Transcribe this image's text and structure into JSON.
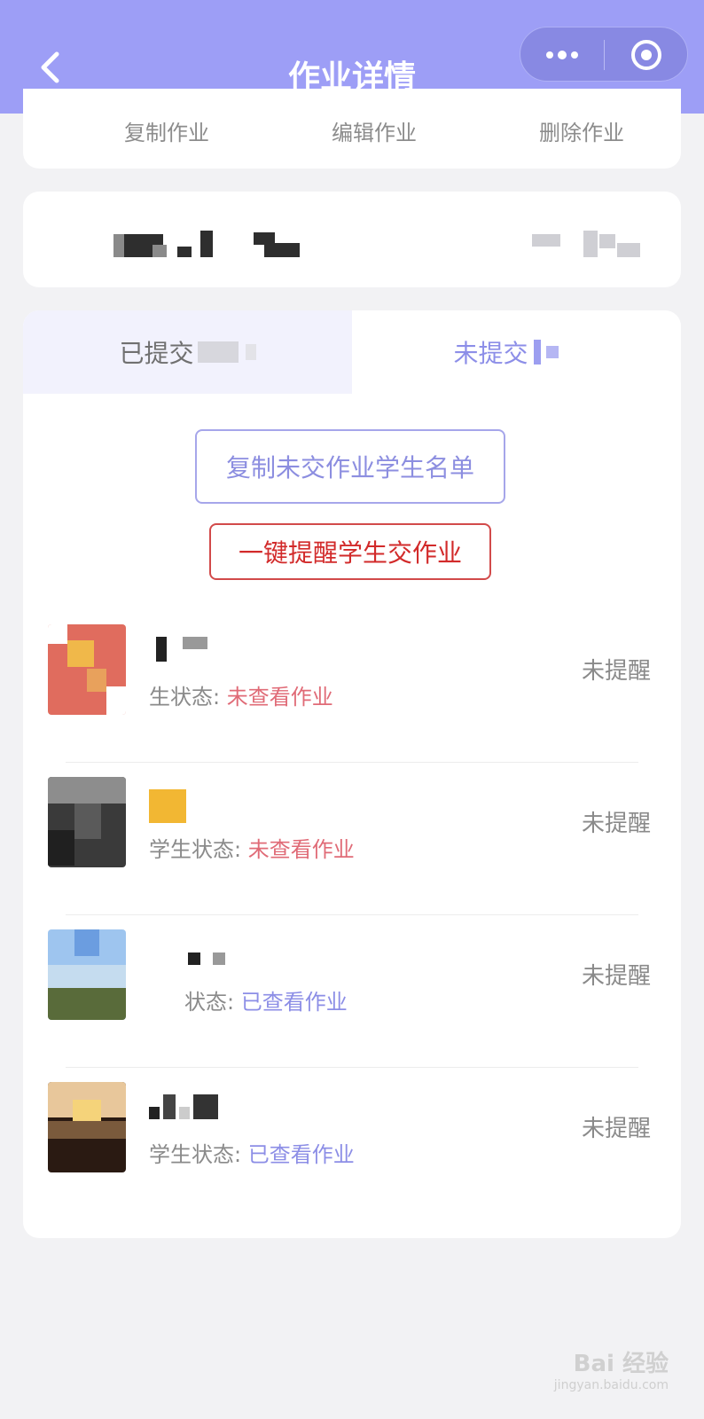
{
  "header": {
    "title": "作业详情",
    "colors": {
      "background": "#9d9ef6",
      "capsule": "#8889e3"
    }
  },
  "actions": {
    "copy_label": "复制作业",
    "edit_label": "编辑作业",
    "delete_label": "删除作业"
  },
  "tabs": {
    "submitted_label": "已提交",
    "unsubmitted_label": "未提交",
    "active": "unsubmitted"
  },
  "buttons": {
    "copy_list_label": "复制未交作业学生名单",
    "remind_all_label": "一键提醒学生交作业"
  },
  "students": [
    {
      "status_prefix": "生状态:",
      "status": "未查看作业",
      "status_type": "unread",
      "remind_state": "未提醒"
    },
    {
      "status_prefix": "学生状态:",
      "status": "未查看作业",
      "status_type": "unread",
      "remind_state": "未提醒"
    },
    {
      "status_prefix": "状态:",
      "status": "已查看作业",
      "status_type": "read",
      "remind_state": "未提醒"
    },
    {
      "status_prefix": "学生状态:",
      "status": "已查看作业",
      "status_type": "read",
      "remind_state": "未提醒"
    }
  ],
  "watermark": {
    "main": "Bai 经验",
    "sub": "jingyan.baidu.com"
  }
}
